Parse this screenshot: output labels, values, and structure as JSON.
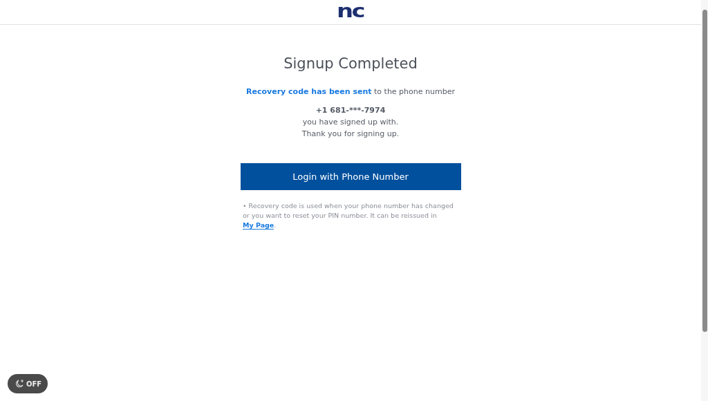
{
  "header": {
    "logo": "nc"
  },
  "title": "Signup Completed",
  "message": {
    "sent": "**Recovery code has been sent** to the phone number",
    "phone": "+1 681-***-7974",
    "lines": [
      "you have signed up with.",
      "Thank you for signing up."
    ]
  },
  "login_button": "Login with Phone Number",
  "note": {
    "bullet": "•",
    "text": "Recovery code is used when your phone number has changed or you want to reset your PIN number. It can be reissued in ",
    "link": "My Page",
    "after": "."
  },
  "dark_mode": {
    "label": "OFF",
    "on": false
  }
}
